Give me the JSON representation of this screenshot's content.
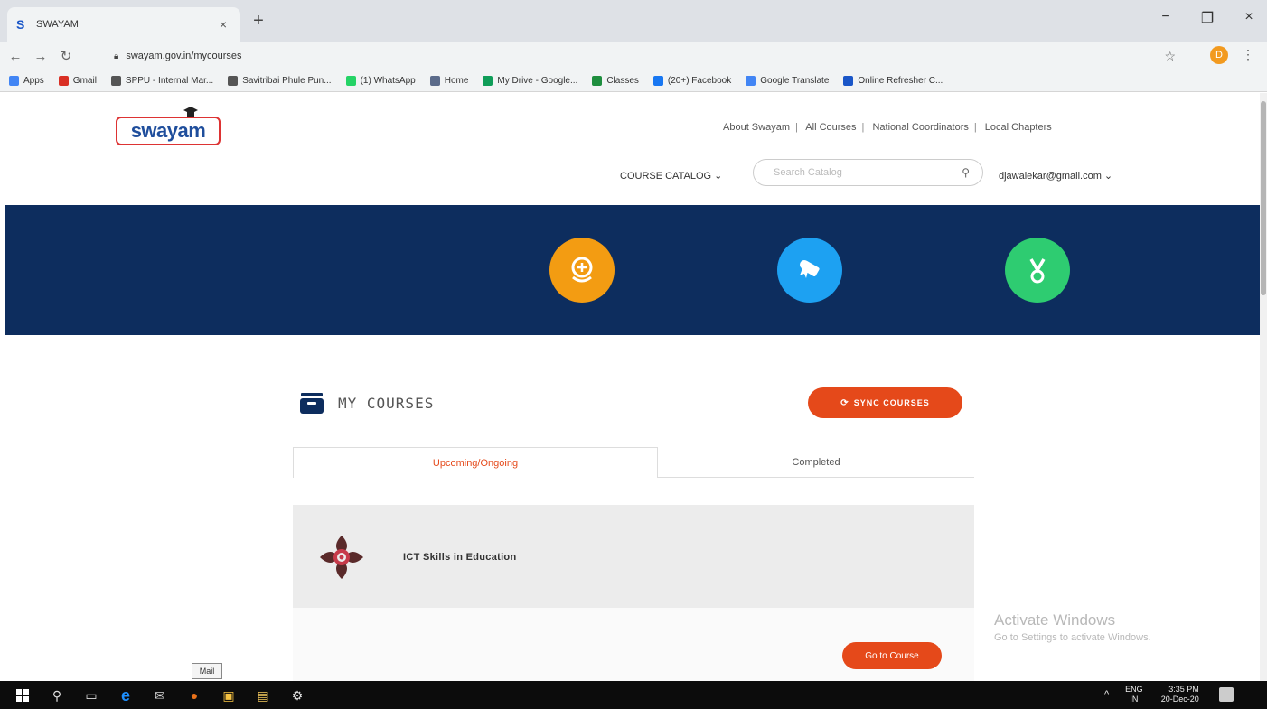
{
  "browser": {
    "tab_title": "SWAYAM",
    "tab_favicon": "S",
    "tab_close": "×",
    "new_tab": "+",
    "url": "swayam.gov.in/mycourses",
    "window_min": "−",
    "window_max": "❐",
    "window_close": "×",
    "profile_initial": "D"
  },
  "bookmarks": [
    {
      "label": "Apps",
      "icon": "apps-grid-icon",
      "color": "#4285f4"
    },
    {
      "label": "Gmail",
      "icon": "gmail-icon",
      "color": "#d93025"
    },
    {
      "label": "SPPU - Internal Mar...",
      "icon": "globe-icon",
      "color": "#555555"
    },
    {
      "label": "Savitribai Phule Pun...",
      "icon": "globe-icon",
      "color": "#555555"
    },
    {
      "label": "(1) WhatsApp",
      "icon": "whatsapp-icon",
      "color": "#25d366"
    },
    {
      "label": "Home",
      "icon": "home-icon",
      "color": "#5b6b8a"
    },
    {
      "label": "My Drive - Google...",
      "icon": "drive-icon",
      "color": "#0f9d58"
    },
    {
      "label": "Classes",
      "icon": "classroom-icon",
      "color": "#1e8e3e"
    },
    {
      "label": "(20+) Facebook",
      "icon": "facebook-icon",
      "color": "#1877f2"
    },
    {
      "label": "Google Translate",
      "icon": "translate-icon",
      "color": "#4285f4"
    },
    {
      "label": "Online Refresher C...",
      "icon": "swayam-icon",
      "color": "#1a56c8"
    }
  ],
  "header": {
    "logo_text": "swayam",
    "top_links": [
      "About Swayam",
      "All Courses",
      "National Coordinators",
      "Local Chapters"
    ],
    "catalog_label": "COURSE CATALOG ⌄",
    "search_placeholder": "Search Catalog",
    "user_email": "djawalekar@gmail.com ⌄"
  },
  "banner": {
    "color": "#0d2d5e",
    "badges": [
      {
        "name": "enrolled-badge-icon",
        "color": "#f39c12"
      },
      {
        "name": "certificate-badge-icon",
        "color": "#1da1f2"
      },
      {
        "name": "medal-badge-icon",
        "color": "#2ecc71"
      }
    ]
  },
  "my_courses": {
    "title": "MY COURSES",
    "sync_label": "SYNC COURSES",
    "tabs": [
      {
        "label": "Upcoming/Ongoing",
        "active": true
      },
      {
        "label": "Completed",
        "active": false
      }
    ],
    "courses": [
      {
        "name": "ICT Skills in Education",
        "action": "Go to Course"
      }
    ]
  },
  "watermark": {
    "title": "Activate Windows",
    "subtitle": "Go to Settings to activate Windows."
  },
  "taskbar": {
    "tooltip": "Mail",
    "lang_top": "ENG",
    "lang_bottom": "IN",
    "time": "3:35 PM",
    "date": "20-Dec-20"
  },
  "colors": {
    "accent": "#e5491a",
    "banner": "#0d2d5e"
  }
}
